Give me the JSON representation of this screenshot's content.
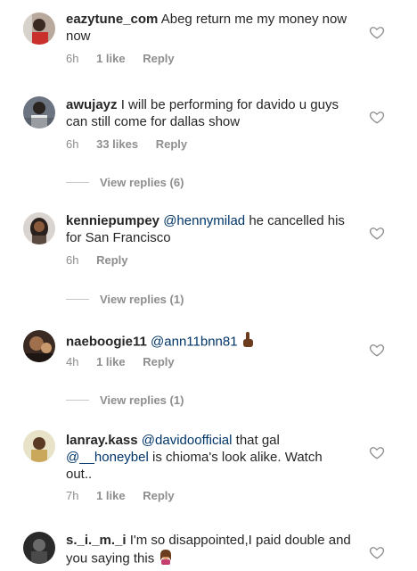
{
  "comments": [
    {
      "username": "eazytune_com",
      "text": "Abeg return me my money now now",
      "time": "6h",
      "likes": "1 like",
      "reply": "Reply",
      "avatar": "user-avatar"
    },
    {
      "username": "awujayz",
      "text": "I will be performing for davido u guys can still come for dallas show",
      "time": "6h",
      "likes": "33 likes",
      "reply": "Reply",
      "view_replies": "View replies (6)",
      "avatar": "user-avatar"
    },
    {
      "username": "kenniepumpey",
      "mention": "@hennymilad",
      "text": "he cancelled his for San Francisco",
      "time": "6h",
      "reply": "Reply",
      "view_replies": "View replies (1)",
      "avatar": "user-avatar"
    },
    {
      "username": "naeboogie11",
      "mention": "@ann11bnn81",
      "emoji": "pointing-up-emoji",
      "time": "4h",
      "likes": "1 like",
      "reply": "Reply",
      "view_replies": "View replies (1)",
      "avatar": "user-avatar"
    },
    {
      "username": "lanray.kass",
      "mention": "@davidoofficial",
      "text_a": "that gal",
      "mention2": "@__honeybel",
      "text_b": "is chioma's look alike. Watch out..",
      "time": "7h",
      "likes": "1 like",
      "reply": "Reply",
      "avatar": "user-avatar"
    },
    {
      "username": "s._i._m._i",
      "text": "I'm so disappointed,I paid double and you saying this",
      "emoji": "woman-facepalming-emoji",
      "avatar": "user-avatar"
    }
  ],
  "icons": {
    "like": "heart-icon"
  },
  "colors": {
    "text": "#262626",
    "muted": "#8e8e8e",
    "mention": "#003569"
  }
}
